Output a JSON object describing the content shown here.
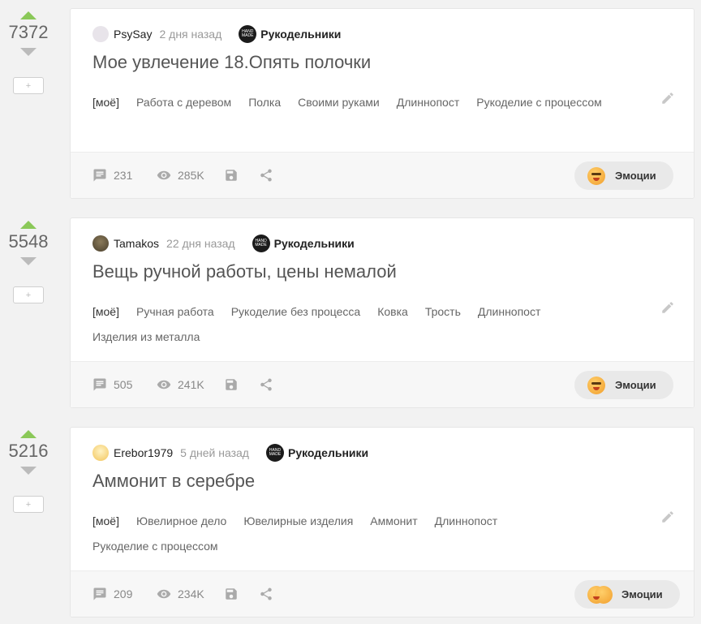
{
  "posts": [
    {
      "rating": "7372",
      "author": "PsySay",
      "time": "2 дня назад",
      "community": "Рукодельники",
      "title": "Мое увлечение 18.Опять полочки",
      "tags": [
        "[моё]",
        "Работа с деревом",
        "Полка",
        "Своими руками",
        "Длиннопост",
        "Рукоделие с процессом"
      ],
      "comments": "231",
      "views": "285K",
      "emotions_label": "Эмоции"
    },
    {
      "rating": "5548",
      "author": "Tamakos",
      "time": "22 дня назад",
      "community": "Рукодельники",
      "title": "Вещь ручной работы, цены немалой",
      "tags": [
        "[моё]",
        "Ручная работа",
        "Рукоделие без процесса",
        "Ковка",
        "Трость",
        "Длиннопост",
        "Изделия из металла"
      ],
      "comments": "505",
      "views": "241K",
      "emotions_label": "Эмоции"
    },
    {
      "rating": "5216",
      "author": "Erebor1979",
      "time": "5 дней назад",
      "community": "Рукодельники",
      "title": "Аммонит в серебре",
      "tags": [
        "[моё]",
        "Ювелирное дело",
        "Ювелирные изделия",
        "Аммонит",
        "Длиннопост",
        "Рукоделие с процессом"
      ],
      "comments": "209",
      "views": "234K",
      "emotions_label": "Эмоции"
    }
  ],
  "plus_label": "+",
  "colors": {
    "upvote": "#8ac858",
    "downvote": "#bbbbbb",
    "background": "#f2f2f2"
  },
  "icons": [
    "comment-icon",
    "views-icon",
    "save-icon",
    "share-icon",
    "edit-icon",
    "emoji-icon"
  ]
}
